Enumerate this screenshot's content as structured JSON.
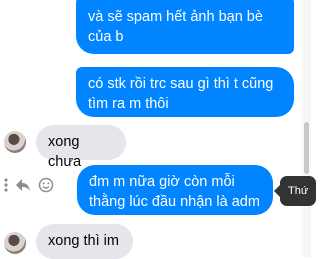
{
  "messages": [
    {
      "direction": "outgoing",
      "text": "và sẽ spam hết ảnh bạn bè của b"
    },
    {
      "direction": "outgoing",
      "text": "có stk rồi trc sau gì thì   t cũng tìm ra m thôi"
    },
    {
      "direction": "incoming",
      "text": "xong chưa"
    },
    {
      "direction": "outgoing",
      "text": "đm m nữa giờ còn mỗi thằng lúc đầu nhận là adm"
    },
    {
      "direction": "incoming",
      "text": "xong thì im"
    }
  ],
  "tooltip": {
    "text": "Thứ"
  },
  "icons": {
    "more": "more-options-icon",
    "reply": "reply-icon",
    "react": "emoji-reaction-icon"
  },
  "colors": {
    "outgoing_bubble": "#0084ff",
    "incoming_bubble": "#e4e6eb",
    "tooltip_bg": "#333333"
  }
}
